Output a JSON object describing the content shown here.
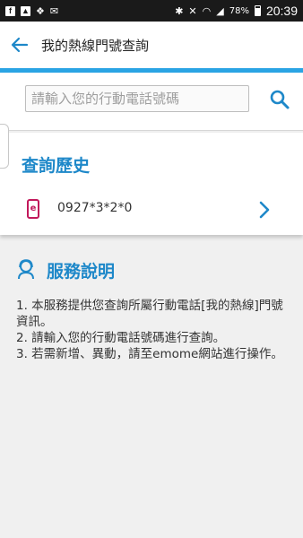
{
  "status_bar": {
    "battery": "78%",
    "time": "20:39"
  },
  "app_bar": {
    "title": "我的熱線門號查詢",
    "back_icon": "arrow-left-icon"
  },
  "search": {
    "placeholder": "請輸入您的行動電話號碼",
    "value": "",
    "button_icon": "search-icon"
  },
  "history": {
    "title": "查詢歷史",
    "items": [
      {
        "number": "0927*3*2*0",
        "icon": "phone-icon",
        "chevron": "chevron-right-icon"
      }
    ]
  },
  "service": {
    "title": "服務說明",
    "icon": "service-agent-icon",
    "items": [
      "1. 本服務提供您查詢所屬行動電話[我的熱線]門號資訊。",
      "2. 請輸入您的行動電話號碼進行查詢。",
      "3. 若需新增、異動，請至emome網站進行操作。"
    ]
  },
  "colors": {
    "accent": "#1e88c9",
    "accent_line": "#2aa4e4",
    "history_icon": "#c2185b"
  }
}
